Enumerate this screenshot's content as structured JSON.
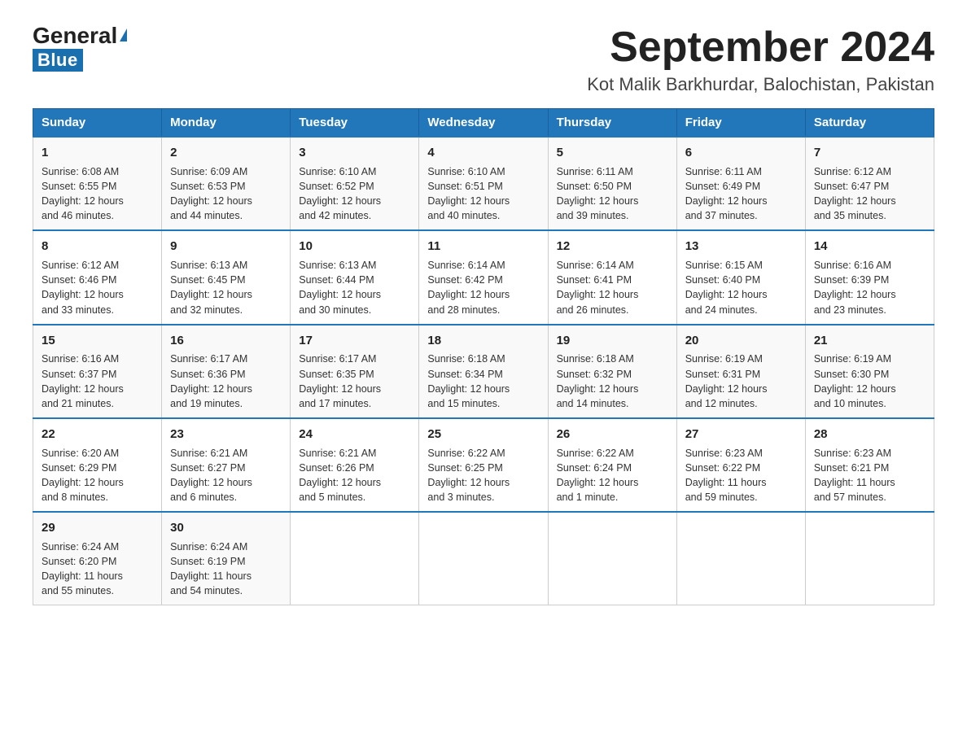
{
  "logo": {
    "general": "General",
    "blue": "Blue",
    "triangle": "▲"
  },
  "header": {
    "month_title": "September 2024",
    "subtitle": "Kot Malik Barkhurdar, Balochistan, Pakistan"
  },
  "days_of_week": [
    "Sunday",
    "Monday",
    "Tuesday",
    "Wednesday",
    "Thursday",
    "Friday",
    "Saturday"
  ],
  "weeks": [
    [
      {
        "day": "1",
        "sunrise": "6:08 AM",
        "sunset": "6:55 PM",
        "daylight": "12 hours and 46 minutes."
      },
      {
        "day": "2",
        "sunrise": "6:09 AM",
        "sunset": "6:53 PM",
        "daylight": "12 hours and 44 minutes."
      },
      {
        "day": "3",
        "sunrise": "6:10 AM",
        "sunset": "6:52 PM",
        "daylight": "12 hours and 42 minutes."
      },
      {
        "day": "4",
        "sunrise": "6:10 AM",
        "sunset": "6:51 PM",
        "daylight": "12 hours and 40 minutes."
      },
      {
        "day": "5",
        "sunrise": "6:11 AM",
        "sunset": "6:50 PM",
        "daylight": "12 hours and 39 minutes."
      },
      {
        "day": "6",
        "sunrise": "6:11 AM",
        "sunset": "6:49 PM",
        "daylight": "12 hours and 37 minutes."
      },
      {
        "day": "7",
        "sunrise": "6:12 AM",
        "sunset": "6:47 PM",
        "daylight": "12 hours and 35 minutes."
      }
    ],
    [
      {
        "day": "8",
        "sunrise": "6:12 AM",
        "sunset": "6:46 PM",
        "daylight": "12 hours and 33 minutes."
      },
      {
        "day": "9",
        "sunrise": "6:13 AM",
        "sunset": "6:45 PM",
        "daylight": "12 hours and 32 minutes."
      },
      {
        "day": "10",
        "sunrise": "6:13 AM",
        "sunset": "6:44 PM",
        "daylight": "12 hours and 30 minutes."
      },
      {
        "day": "11",
        "sunrise": "6:14 AM",
        "sunset": "6:42 PM",
        "daylight": "12 hours and 28 minutes."
      },
      {
        "day": "12",
        "sunrise": "6:14 AM",
        "sunset": "6:41 PM",
        "daylight": "12 hours and 26 minutes."
      },
      {
        "day": "13",
        "sunrise": "6:15 AM",
        "sunset": "6:40 PM",
        "daylight": "12 hours and 24 minutes."
      },
      {
        "day": "14",
        "sunrise": "6:16 AM",
        "sunset": "6:39 PM",
        "daylight": "12 hours and 23 minutes."
      }
    ],
    [
      {
        "day": "15",
        "sunrise": "6:16 AM",
        "sunset": "6:37 PM",
        "daylight": "12 hours and 21 minutes."
      },
      {
        "day": "16",
        "sunrise": "6:17 AM",
        "sunset": "6:36 PM",
        "daylight": "12 hours and 19 minutes."
      },
      {
        "day": "17",
        "sunrise": "6:17 AM",
        "sunset": "6:35 PM",
        "daylight": "12 hours and 17 minutes."
      },
      {
        "day": "18",
        "sunrise": "6:18 AM",
        "sunset": "6:34 PM",
        "daylight": "12 hours and 15 minutes."
      },
      {
        "day": "19",
        "sunrise": "6:18 AM",
        "sunset": "6:32 PM",
        "daylight": "12 hours and 14 minutes."
      },
      {
        "day": "20",
        "sunrise": "6:19 AM",
        "sunset": "6:31 PM",
        "daylight": "12 hours and 12 minutes."
      },
      {
        "day": "21",
        "sunrise": "6:19 AM",
        "sunset": "6:30 PM",
        "daylight": "12 hours and 10 minutes."
      }
    ],
    [
      {
        "day": "22",
        "sunrise": "6:20 AM",
        "sunset": "6:29 PM",
        "daylight": "12 hours and 8 minutes."
      },
      {
        "day": "23",
        "sunrise": "6:21 AM",
        "sunset": "6:27 PM",
        "daylight": "12 hours and 6 minutes."
      },
      {
        "day": "24",
        "sunrise": "6:21 AM",
        "sunset": "6:26 PM",
        "daylight": "12 hours and 5 minutes."
      },
      {
        "day": "25",
        "sunrise": "6:22 AM",
        "sunset": "6:25 PM",
        "daylight": "12 hours and 3 minutes."
      },
      {
        "day": "26",
        "sunrise": "6:22 AM",
        "sunset": "6:24 PM",
        "daylight": "12 hours and 1 minute."
      },
      {
        "day": "27",
        "sunrise": "6:23 AM",
        "sunset": "6:22 PM",
        "daylight": "11 hours and 59 minutes."
      },
      {
        "day": "28",
        "sunrise": "6:23 AM",
        "sunset": "6:21 PM",
        "daylight": "11 hours and 57 minutes."
      }
    ],
    [
      {
        "day": "29",
        "sunrise": "6:24 AM",
        "sunset": "6:20 PM",
        "daylight": "11 hours and 55 minutes."
      },
      {
        "day": "30",
        "sunrise": "6:24 AM",
        "sunset": "6:19 PM",
        "daylight": "11 hours and 54 minutes."
      },
      null,
      null,
      null,
      null,
      null
    ]
  ],
  "labels": {
    "sunrise": "Sunrise:",
    "sunset": "Sunset:",
    "daylight": "Daylight:"
  }
}
